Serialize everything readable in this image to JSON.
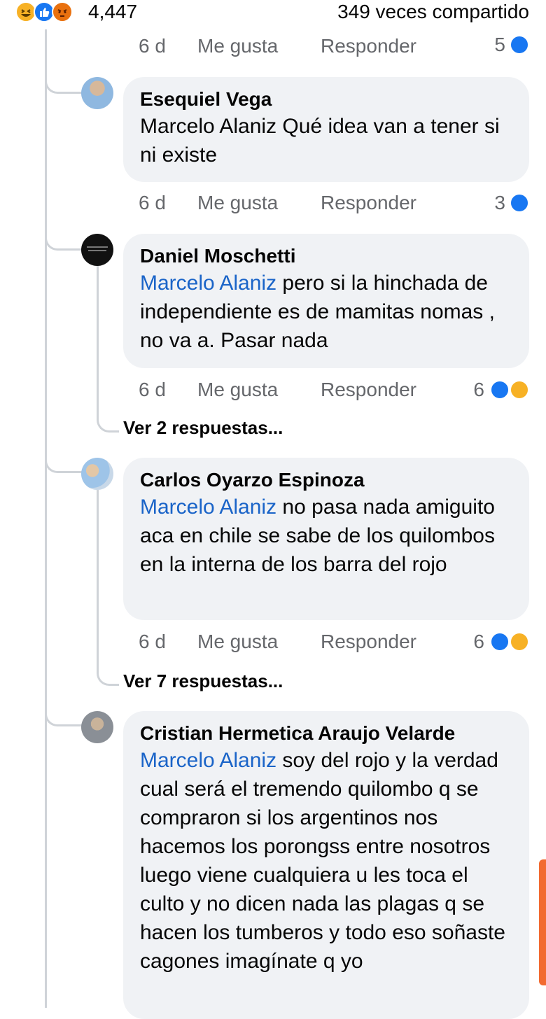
{
  "header": {
    "reaction_count": "4,447",
    "reaction_icons": [
      "haha-icon",
      "like-icon",
      "angry-icon"
    ],
    "shares": "349 veces compartido"
  },
  "top_meta": {
    "time": "6 d",
    "like": "Me gusta",
    "reply": "Responder",
    "reactions": "5"
  },
  "comments": [
    {
      "author": "Esequiel Vega",
      "mention": "",
      "text": "Marcelo Alaniz Qué idea van a tener si ni existe",
      "time": "6 d",
      "like": "Me gusta",
      "reply": "Responder",
      "reactions": "3"
    },
    {
      "author": "Daniel Moschetti",
      "mention": "Marcelo Alaniz",
      "text": " pero si la hinchada de independiente es de mamitas nomas , no va a. Pasar nada",
      "time": "6 d",
      "like": "Me gusta",
      "reply": "Responder",
      "reactions": "6",
      "view_replies": "Ver 2 respuestas..."
    },
    {
      "author": "Carlos Oyarzo Espinoza",
      "mention": "Marcelo Alaniz",
      "text": " no pasa nada amiguito aca en chile se sabe de los quilombos en la interna de los barra del rojo",
      "time": "6 d",
      "like": "Me gusta",
      "reply": "Responder",
      "reactions": "6",
      "view_replies": "Ver 7 respuestas..."
    },
    {
      "author": "Cristian Hermetica Araujo Velarde",
      "mention": "Marcelo Alaniz",
      "text": " soy del rojo  y la verdad cual será el tremendo quilombo q se compraron si los argentinos nos hacemos los porongss entre nosotros luego viene cualquiera u les toca el culto y no dicen nada las plagas q se hacen los tumberos y todo eso soñaste cagones imagínate q yo"
    }
  ],
  "colors": {
    "mention": "#1a64c8",
    "like": "#1877f2",
    "haha": "#f7b125",
    "angry": "#e9710f",
    "bubble": "#f0f2f5",
    "meta": "#65676b"
  }
}
